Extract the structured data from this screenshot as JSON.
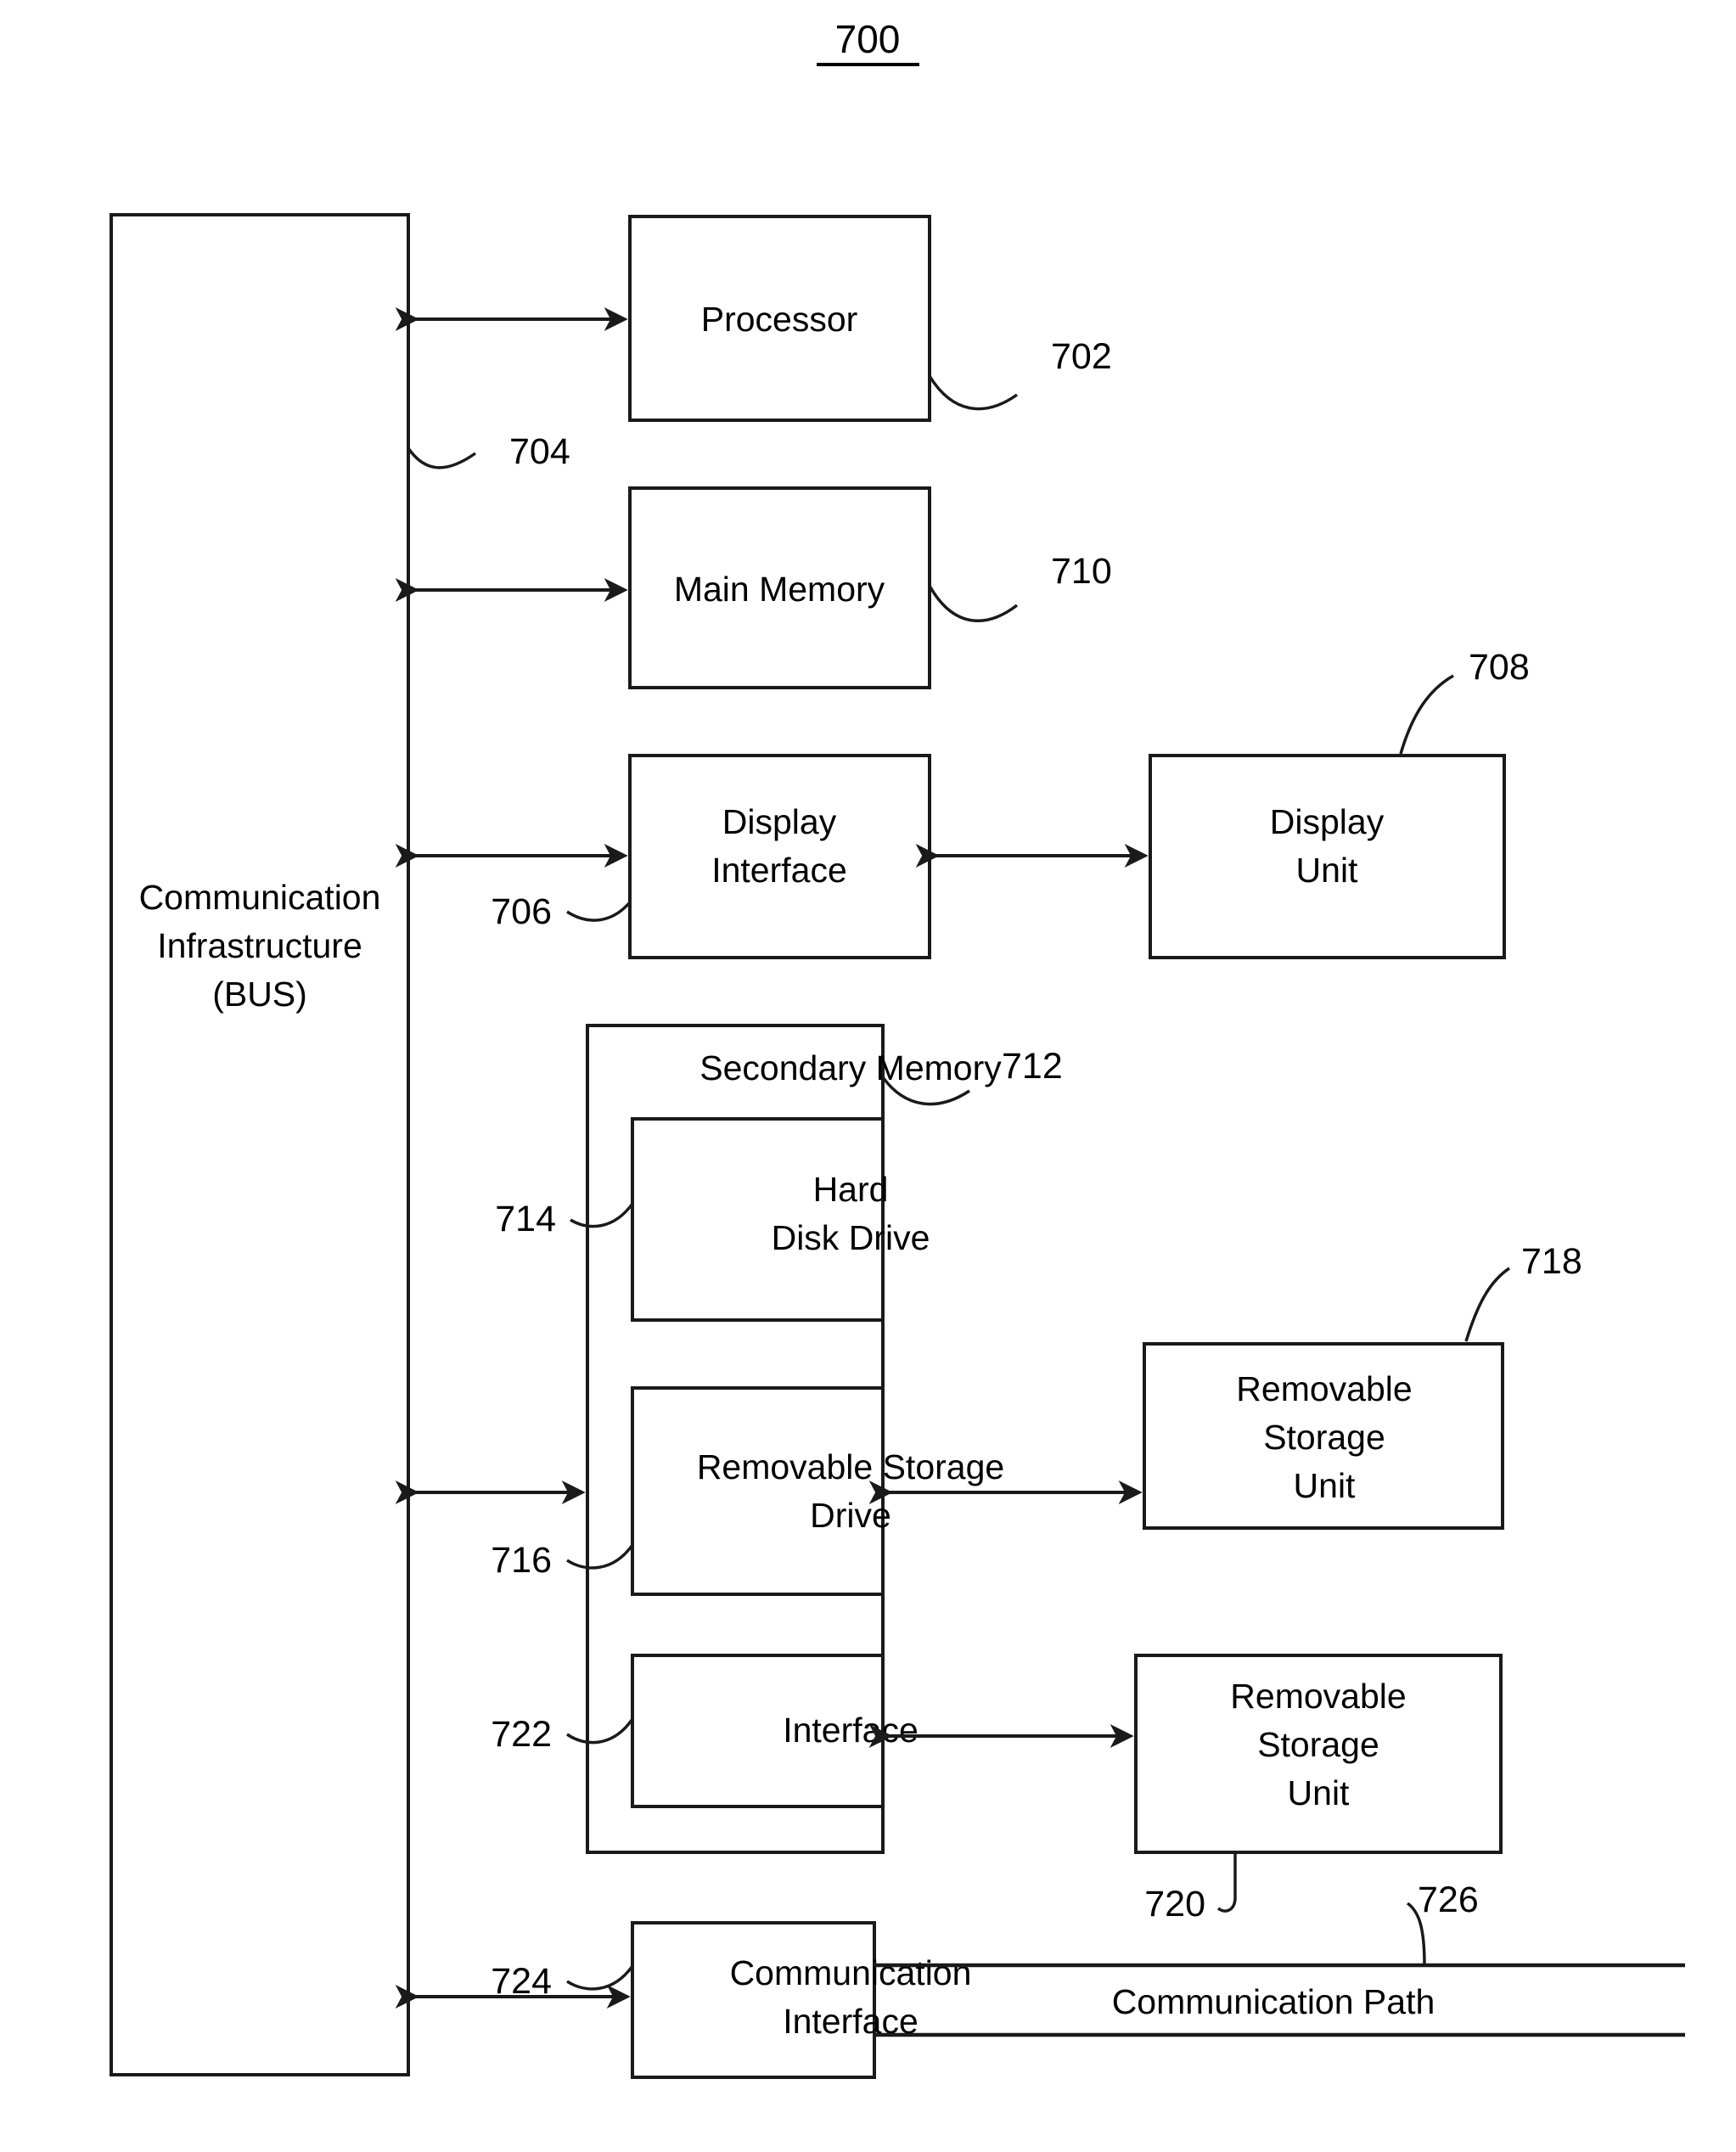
{
  "figure": {
    "title": "700",
    "title_underlined": true,
    "background_color": "#ffffff",
    "line_color": "#1a1a1a"
  },
  "blocks": {
    "bus": {
      "line1": "Communication",
      "line2": "Infrastructure",
      "line3": "(BUS)",
      "ref": "704"
    },
    "processor": {
      "label": "Processor",
      "ref": "702"
    },
    "main_memory": {
      "label": "Main Memory",
      "ref": "710"
    },
    "display_interface": {
      "line1": "Display",
      "line2": "Interface",
      "ref": "706"
    },
    "display_unit": {
      "line1": "Display",
      "line2": "Unit",
      "ref": "708"
    },
    "secondary_memory": {
      "label": "Secondary Memory",
      "ref": "712"
    },
    "hard_disk_drive": {
      "line1": "Hard",
      "line2": "Disk Drive",
      "ref": "714"
    },
    "removable_storage_drive": {
      "line1": "Removable Storage",
      "line2": "Drive",
      "ref": "716"
    },
    "removable_storage_unit_upper": {
      "line1": "Removable",
      "line2": "Storage",
      "line3": "Unit",
      "ref": "718"
    },
    "interface": {
      "label": "Interface",
      "ref": "722"
    },
    "removable_storage_unit_lower": {
      "line1": "Removable",
      "line2": "Storage",
      "line3": "Unit",
      "ref": "720"
    },
    "communication_interface": {
      "line1": "Communication",
      "line2": "Interface",
      "ref": "724"
    },
    "communication_path": {
      "label": "Communication Path",
      "ref": "726"
    }
  }
}
